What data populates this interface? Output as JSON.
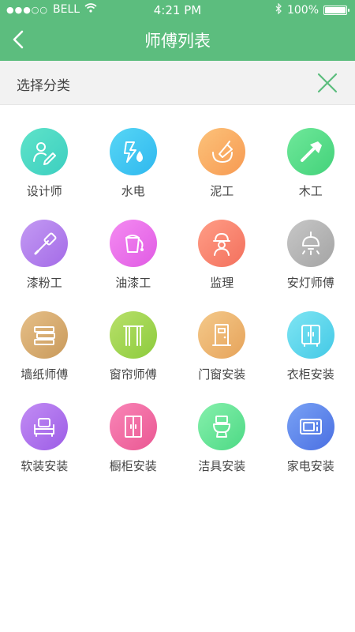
{
  "status_bar": {
    "signal": "●●●○○",
    "carrier": "BELL",
    "time": "4:21 PM",
    "battery": "100%",
    "battery_level": 1.0
  },
  "header": {
    "title": "师傅列表",
    "back_icon": "chevron-left-icon",
    "background_color": "#5cbd7e"
  },
  "filter": {
    "label": "选择分类",
    "close_icon": "close-icon",
    "accent_color": "#5cbd7e"
  },
  "categories": [
    {
      "label": "设计师",
      "icon": "designer-icon",
      "colors": [
        "#5fe3c9",
        "#3ccfc0"
      ]
    },
    {
      "label": "水电",
      "icon": "plumbing-electric-icon",
      "colors": [
        "#57d6f5",
        "#2fb8ef"
      ]
    },
    {
      "label": "泥工",
      "icon": "trowel-icon",
      "colors": [
        "#fcc27a",
        "#f79a52"
      ]
    },
    {
      "label": "木工",
      "icon": "hammer-icon",
      "colors": [
        "#6fe89a",
        "#43d27a"
      ]
    },
    {
      "label": "漆粉工",
      "icon": "brush-icon",
      "colors": [
        "#c39af3",
        "#a46be7"
      ]
    },
    {
      "label": "油漆工",
      "icon": "paint-bucket-icon",
      "colors": [
        "#f48bf1",
        "#e05be4"
      ]
    },
    {
      "label": "监理",
      "icon": "helmet-worker-icon",
      "colors": [
        "#ff9d86",
        "#f3705d"
      ]
    },
    {
      "label": "安灯师傅",
      "icon": "lamp-icon",
      "colors": [
        "#c7c7c7",
        "#a4a4a4"
      ]
    },
    {
      "label": "墙纸师傅",
      "icon": "wallpaper-icon",
      "colors": [
        "#e6bf88",
        "#c99a5b"
      ]
    },
    {
      "label": "窗帘师傅",
      "icon": "curtain-icon",
      "colors": [
        "#b8e06a",
        "#8ccb3c"
      ]
    },
    {
      "label": "门窗安装",
      "icon": "door-icon",
      "colors": [
        "#f4c98a",
        "#e6a35a"
      ]
    },
    {
      "label": "衣柜安装",
      "icon": "wardrobe-icon",
      "colors": [
        "#7fe5f3",
        "#43c9e6"
      ]
    },
    {
      "label": "软装安装",
      "icon": "sofa-icon",
      "colors": [
        "#c28cf4",
        "#9c5de6"
      ]
    },
    {
      "label": "橱柜安装",
      "icon": "cabinet-icon",
      "colors": [
        "#f985b7",
        "#ea5792"
      ]
    },
    {
      "label": "洁具安装",
      "icon": "toilet-icon",
      "colors": [
        "#86f0ac",
        "#4dd985"
      ]
    },
    {
      "label": "家电安装",
      "icon": "microwave-icon",
      "colors": [
        "#79a2f5",
        "#4a6fe2"
      ]
    }
  ]
}
